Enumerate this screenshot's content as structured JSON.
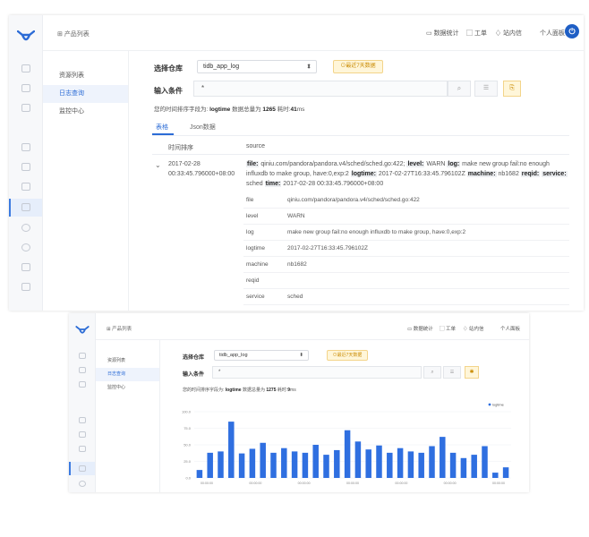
{
  "screen1": {
    "header": {
      "breadcrumb": "产品列表",
      "stats": "数据统计",
      "tickets": "工单",
      "messages": "站内信",
      "user": "个人面板"
    },
    "subnav": [
      "资源列表",
      "日志查询",
      "监控中心"
    ],
    "query": {
      "repo_label": "选择仓库",
      "repo_value": "tidb_app_log",
      "warning": "最近7天数据",
      "condition_label": "输入条件",
      "condition_value": "*"
    },
    "info": {
      "prefix": "您的时间排序字段为:",
      "field": "logtime",
      "total_label": "数据总量为",
      "total": "1265",
      "time_label": "耗时:",
      "time": "41",
      "time_unit": "ms"
    },
    "tabs": [
      "表格",
      "Json数据"
    ],
    "table": {
      "col_time": "时间排序",
      "col_source": "source",
      "row_time": "2017-02-28 00:33:45.796000+08:00",
      "source": [
        {
          "k": "file:",
          "v": "qiniu.com/pandora/pandora.v4/sched/sched.go:422;"
        },
        {
          "k": "level:",
          "v": "WARN"
        },
        {
          "k": "log:",
          "v": "make new group fail:no enough influxdb to make group, have:0,exp:2"
        },
        {
          "k": "logtime:",
          "v": "2017-02-27T16:33:45.796102Z"
        },
        {
          "k": "machine:",
          "v": "nb1682"
        },
        {
          "k": "reqid:",
          "v": ""
        },
        {
          "k": "service:",
          "v": "sched"
        },
        {
          "k": "time:",
          "v": "2017-02-28 00:33:45.796000+08:00"
        }
      ],
      "details": [
        {
          "k": "file",
          "v": "qiniu.com/pandora/pandora.v4/sched/sched.go:422"
        },
        {
          "k": "level",
          "v": "WARN"
        },
        {
          "k": "log",
          "v": "make new group fail:no enough influxdb to make group, have:0,exp:2"
        },
        {
          "k": "logtime",
          "v": "2017-02-27T16:33:45.796102Z"
        },
        {
          "k": "machine",
          "v": "nb1682"
        },
        {
          "k": "reqid",
          "v": ""
        },
        {
          "k": "service",
          "v": "sched"
        }
      ]
    }
  },
  "screen2": {
    "header": {
      "breadcrumb": "产品列表",
      "stats": "数据统计",
      "tickets": "工单",
      "messages": "站内信",
      "user": "个人面板"
    },
    "subnav": [
      "资源列表",
      "日志查询",
      "监控中心"
    ],
    "query": {
      "repo_label": "选择仓库",
      "repo_value": "tidb_app_log",
      "warning": "最近7天数据",
      "condition_label": "输入条件",
      "condition_value": "*"
    },
    "info": {
      "prefix": "您的时间排序字段为:",
      "field": "logtime",
      "total_label": "数据总量为",
      "total": "1275",
      "time_label": "耗时:",
      "time": "9",
      "time_unit": "ms"
    }
  },
  "chart_data": {
    "type": "bar",
    "legend": "logtime",
    "legend_position": "top-right",
    "ylim": [
      0,
      100
    ],
    "y_ticks": [
      "100.0",
      "75.0",
      "50.0",
      "25.0",
      "0.0"
    ],
    "x_tick_labels": [
      "00:00:00",
      "00:00:00",
      "00:00:00",
      "00:00:00",
      "00:00:00",
      "00:00:00",
      "00:00:00"
    ],
    "values": [
      12,
      38,
      40,
      85,
      37,
      44,
      53,
      38,
      45,
      40,
      38,
      50,
      35,
      42,
      72,
      55,
      43,
      49,
      38,
      45,
      40,
      38,
      48,
      62,
      38,
      30,
      35,
      48,
      8,
      16
    ],
    "bar_color": "#2f6fe0",
    "grid": true
  }
}
